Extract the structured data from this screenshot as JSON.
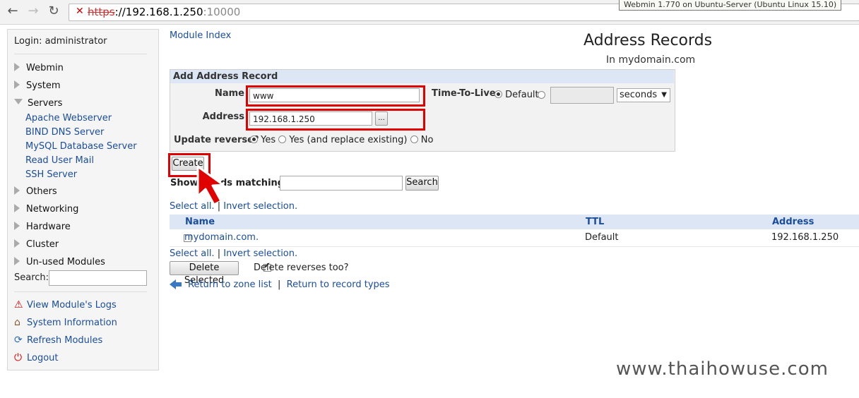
{
  "browser": {
    "url_scheme": "https",
    "url_host": "://192.168.1.250",
    "url_port": ":10000",
    "tooltip": "Webmin 1.770 on Ubuntu-Server (Ubuntu Linux 15.10)"
  },
  "sidebar": {
    "login": "Login: administrator",
    "categories": [
      {
        "label": "Webmin"
      },
      {
        "label": "System"
      },
      {
        "label": "Servers"
      },
      {
        "label": "Others"
      },
      {
        "label": "Networking"
      },
      {
        "label": "Hardware"
      },
      {
        "label": "Cluster"
      },
      {
        "label": "Un-used Modules"
      }
    ],
    "server_modules": [
      "Apache Webserver",
      "BIND DNS Server",
      "MySQL Database Server",
      "Read User Mail",
      "SSH Server"
    ],
    "search_label": "Search:",
    "links": [
      {
        "label": "View Module's Logs",
        "icon": "warning-icon"
      },
      {
        "label": "System Information",
        "icon": "home-icon"
      },
      {
        "label": "Refresh Modules",
        "icon": "refresh-icon"
      },
      {
        "label": "Logout",
        "icon": "power-icon"
      }
    ]
  },
  "main": {
    "module_index": "Module Index",
    "title": "Address Records",
    "subtitle": "In mydomain.com",
    "form": {
      "heading": "Add Address Record",
      "name_label": "Name",
      "name_value": "www",
      "address_label": "Address",
      "address_value": "192.168.1.250",
      "browse_button": "...",
      "ttl_label": "Time-To-Live",
      "ttl_default": "Default",
      "ttl_unit": "seconds",
      "update_reverse_label": "Update reverse?",
      "reverse_yes": "Yes",
      "reverse_replace": "Yes (and replace existing)",
      "reverse_no": "No"
    },
    "create_button": "Create",
    "show_records_prefix": "Show",
    "show_records_suffix": "ds matching:",
    "search_button": "Search",
    "select_all": "Select all.",
    "invert_selection": "Invert selection.",
    "table": {
      "headers": [
        "Name",
        "TTL",
        "Address"
      ],
      "rows": [
        {
          "name": "mydomain.com.",
          "ttl": "Default",
          "address": "192.168.1.250"
        }
      ]
    },
    "delete_button": "Delete Selected",
    "delete_reverses": "Delete reverses too?",
    "return_zone": "Return to zone list",
    "return_types": "Return to record types",
    "separator": "|"
  },
  "watermark": "www.thaihowuse.com",
  "colors": {
    "highlight": "#e00000",
    "link": "#1a4d9c",
    "header_bg": "#dde6f4"
  }
}
